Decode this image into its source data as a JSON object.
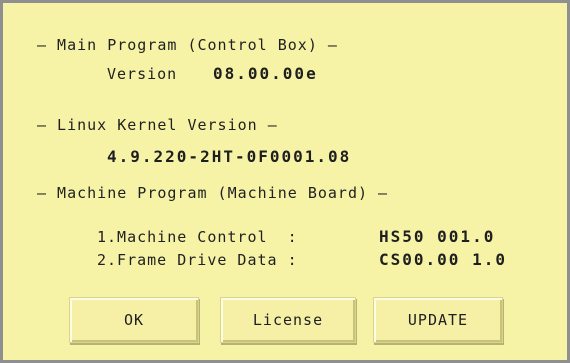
{
  "dialog": {
    "main_program": {
      "heading": "— Main Program (Control Box) —",
      "version_label": "Version",
      "version_value": "08.00.00e"
    },
    "linux_kernel": {
      "heading": "— Linux Kernel Version —",
      "value": "4.9.220-2HT-0F0001.08"
    },
    "machine_program": {
      "heading": "— Machine Program (Machine Board) —",
      "rows": [
        {
          "label": "1.Machine Control  :",
          "value": "HS50 001.0"
        },
        {
          "label": "2.Frame Drive Data :",
          "value": "CS00.00 1.0"
        }
      ]
    },
    "buttons": {
      "ok": "OK",
      "license": "License",
      "update": "UPDATE"
    }
  }
}
